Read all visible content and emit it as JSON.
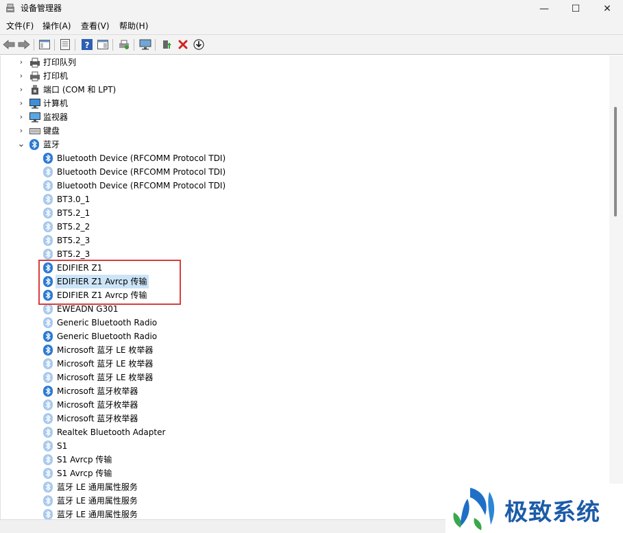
{
  "window": {
    "title": "设备管理器",
    "min_glyph": "—",
    "max_glyph": "☐",
    "close_glyph": "✕"
  },
  "menu": [
    "文件(F)",
    "操作(A)",
    "查看(V)",
    "帮助(H)"
  ],
  "toolbar_icons": [
    "back-arrow-icon",
    "forward-arrow-icon",
    "console-tree-icon",
    "properties-icon",
    "help-icon",
    "action-pane-icon",
    "print-icon",
    "monitor-scan-icon",
    "update-driver-icon",
    "uninstall-x-icon",
    "download-arrow-icon"
  ],
  "categories": [
    {
      "label": "打印队列",
      "icon": "printer-queue-icon",
      "expanded": false
    },
    {
      "label": "打印机",
      "icon": "printer-icon",
      "expanded": false
    },
    {
      "label": "端口 (COM 和 LPT)",
      "icon": "port-icon",
      "expanded": false
    },
    {
      "label": "计算机",
      "icon": "computer-icon",
      "expanded": false
    },
    {
      "label": "监视器",
      "icon": "monitor-icon",
      "expanded": false
    },
    {
      "label": "键盘",
      "icon": "keyboard-icon",
      "expanded": false
    },
    {
      "label": "蓝牙",
      "icon": "bluetooth-icon",
      "expanded": true
    }
  ],
  "bluetooth_devices": [
    {
      "label": "Bluetooth Device (RFCOMM Protocol TDI)",
      "faded": false
    },
    {
      "label": "Bluetooth Device (RFCOMM Protocol TDI)",
      "faded": true
    },
    {
      "label": "Bluetooth Device (RFCOMM Protocol TDI)",
      "faded": true
    },
    {
      "label": "BT3.0_1",
      "faded": true
    },
    {
      "label": "BT5.2_1",
      "faded": true
    },
    {
      "label": "BT5.2_2",
      "faded": true
    },
    {
      "label": "BT5.2_3",
      "faded": true
    },
    {
      "label": "BT5.2_3",
      "faded": true
    },
    {
      "label": "EDIFIER Z1",
      "faded": false
    },
    {
      "label": "EDIFIER Z1 Avrcp 传输",
      "faded": false,
      "selected": true
    },
    {
      "label": "EDIFIER Z1 Avrcp 传输",
      "faded": false
    },
    {
      "label": "EWEADN G301",
      "faded": true
    },
    {
      "label": "Generic Bluetooth Radio",
      "faded": true
    },
    {
      "label": "Generic Bluetooth Radio",
      "faded": false
    },
    {
      "label": "Microsoft 蓝牙 LE 枚举器",
      "faded": false
    },
    {
      "label": "Microsoft 蓝牙 LE 枚举器",
      "faded": true
    },
    {
      "label": "Microsoft 蓝牙 LE 枚举器",
      "faded": true
    },
    {
      "label": "Microsoft 蓝牙枚举器",
      "faded": false
    },
    {
      "label": "Microsoft 蓝牙枚举器",
      "faded": true
    },
    {
      "label": "Microsoft 蓝牙枚举器",
      "faded": true
    },
    {
      "label": "Realtek Bluetooth Adapter",
      "faded": true
    },
    {
      "label": "S1",
      "faded": true
    },
    {
      "label": "S1 Avrcp 传输",
      "faded": true
    },
    {
      "label": "S1 Avrcp 传输",
      "faded": true
    },
    {
      "label": "蓝牙 LE 通用属性服务",
      "faded": true
    },
    {
      "label": "蓝牙 LE 通用属性服务",
      "faded": true
    },
    {
      "label": "蓝牙 LE 通用属性服务",
      "faded": true
    }
  ],
  "watermark": {
    "text": "极致系统"
  },
  "colors": {
    "bt_active": "#2b7ad3",
    "bt_faded": "#a9c9ee",
    "highlight": "#d93c3c",
    "selection": "#cce4f7",
    "brand": "#1c5ca8"
  }
}
